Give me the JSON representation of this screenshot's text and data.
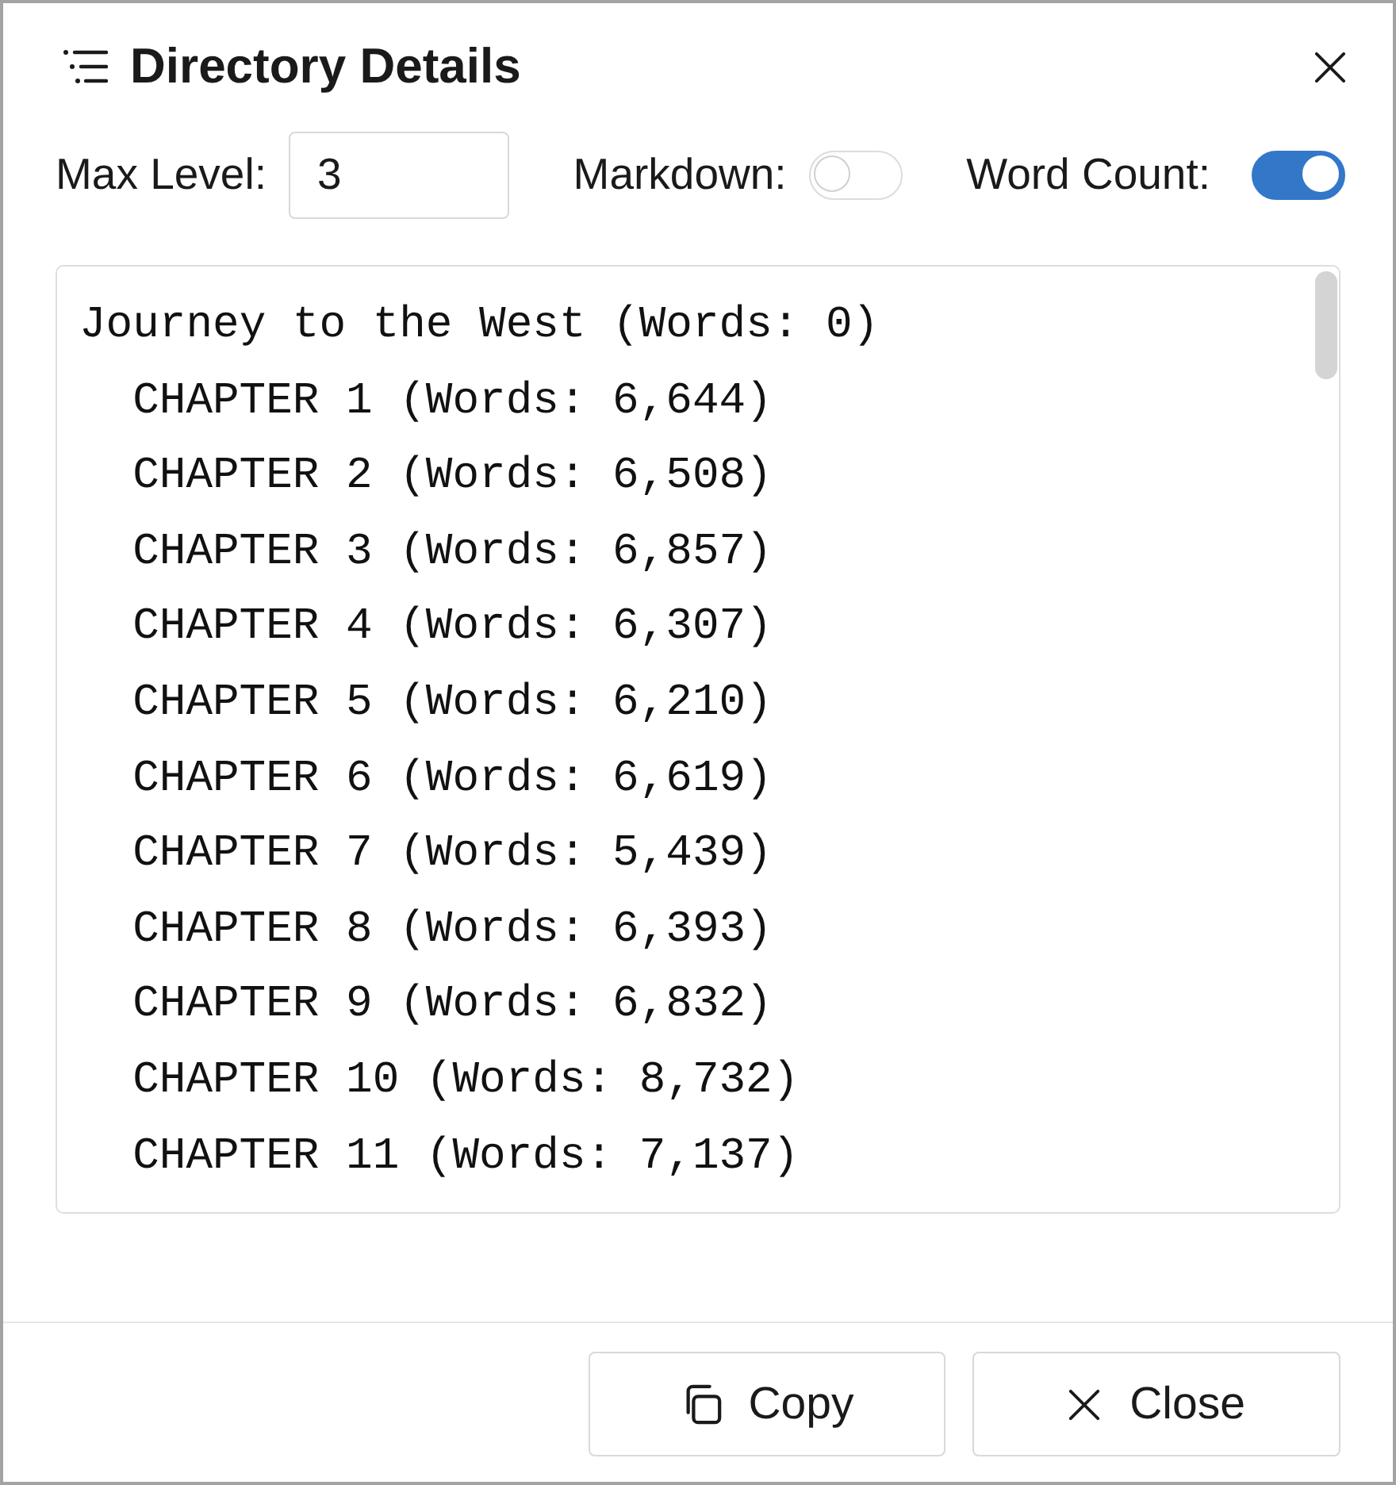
{
  "dialog": {
    "title": "Directory Details"
  },
  "options": [
    {
      "kind": "input",
      "label": "Max Level:",
      "value": "3"
    },
    {
      "kind": "toggle",
      "label": "Markdown:",
      "on": false
    },
    {
      "kind": "toggle",
      "label": "Word Count:",
      "on": true
    }
  ],
  "outline": [
    {
      "text": "Journey to the West (Words: 0)",
      "children": [
        {
          "text": "CHAPTER 1 (Words: 6,644)"
        },
        {
          "text": "CHAPTER 2 (Words: 6,508)"
        },
        {
          "text": "CHAPTER 3 (Words: 6,857)"
        },
        {
          "text": "CHAPTER 4 (Words: 6,307)"
        },
        {
          "text": "CHAPTER 5 (Words: 6,210)"
        },
        {
          "text": "CHAPTER 6 (Words: 6,619)"
        },
        {
          "text": "CHAPTER 7 (Words: 5,439)"
        },
        {
          "text": "CHAPTER 8 (Words: 6,393)"
        },
        {
          "text": "CHAPTER 9 (Words: 6,832)"
        },
        {
          "text": "CHAPTER 10 (Words: 8,732)"
        },
        {
          "text": "CHAPTER 11 (Words: 7,137)"
        }
      ]
    }
  ],
  "buttons": [
    {
      "kind": "copy",
      "label": "Copy"
    },
    {
      "kind": "close",
      "label": "Close"
    }
  ]
}
